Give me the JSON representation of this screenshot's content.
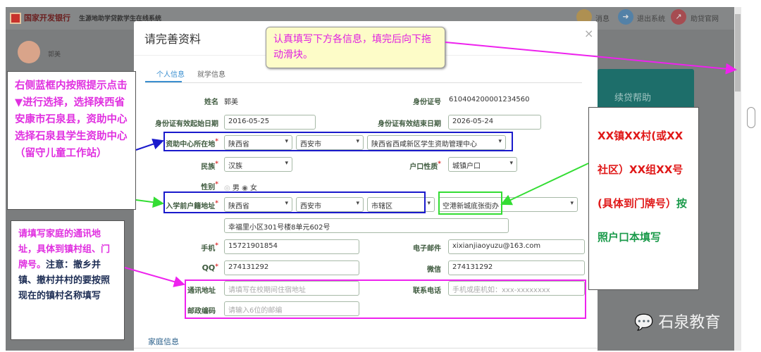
{
  "header": {
    "bank_name": "国家开发银行",
    "system_name": "生源地助学贷款学生在线系统",
    "actions": [
      {
        "label": "消息",
        "icon": "bell-icon",
        "color": "#c9962e"
      },
      {
        "label": "退出系统",
        "icon": "logout-icon",
        "color": "#3f7fb5"
      },
      {
        "label": "助贷官网",
        "icon": "external-link-icon",
        "color": "#b5343a"
      }
    ]
  },
  "sidebar": {
    "user_name": "郭美",
    "card_label": "续贷帮助"
  },
  "modal": {
    "title": "请完善资料",
    "close": "×",
    "tabs": [
      {
        "label": "个人信息",
        "active": true
      },
      {
        "label": "就学信息",
        "active": false
      }
    ],
    "fields": {
      "name": {
        "label": "姓名",
        "value": "郭美"
      },
      "id_number": {
        "label": "身份证号",
        "value": "610404200001234560"
      },
      "id_start": {
        "label": "身份证有效起始日期",
        "value": "2016-05-25"
      },
      "id_end": {
        "label": "身份证有效结束日期",
        "value": "2026-05-24"
      },
      "aid_center": {
        "label": "资助中心所在地",
        "province": "陕西省",
        "city": "西安市",
        "center": "陕西省西咸新区学生资助管理中心"
      },
      "ethnicity": {
        "label": "民族",
        "value": "汉族"
      },
      "hukou_type": {
        "label": "户口性质",
        "value": "城镇户口"
      },
      "gender": {
        "label": "性别",
        "options": [
          "男",
          "女"
        ],
        "selected": "女"
      },
      "hukou_addr": {
        "label": "入学前户籍地址",
        "province": "陕西省",
        "city": "西安市",
        "district": "市辖区",
        "street": "空港新城底张街办",
        "detail": "幸福里小区301号楼8单元602号"
      },
      "mobile": {
        "label": "手机",
        "value": "15721901854"
      },
      "email": {
        "label": "电子邮件",
        "value": "xixianjiaoyuzu@163.com"
      },
      "qq": {
        "label": "QQ",
        "value": "274131292"
      },
      "wechat": {
        "label": "微信",
        "value": "274131292"
      },
      "mail_addr": {
        "label": "通讯地址",
        "placeholder": "请填写在校期间住宿地址"
      },
      "phone": {
        "label": "联系电话",
        "placeholder": "手机或座机如：xxx-xxxxxxxx"
      },
      "postcode": {
        "label": "邮政编码",
        "placeholder": "请输入6位的邮编"
      }
    },
    "section_family": "家庭信息"
  },
  "annotations": {
    "top": "认真填写下方各信息，填完后向下拖动滑块。",
    "left1": "右侧蓝框内按照提示点击▼进行选择，选择陕西省安康市石泉县，资助中心选择石泉县学生资助中心（留守儿童工作站）",
    "left2_pink": "请填写家庭的通讯地址，具体到镇村组、门牌号。",
    "left2_dark": "注意：撤乡并镇、撤村并村的要按照现在的镇村名称填写",
    "right_red": "XX镇XX村(或XX 社区）XX组XX号(具体到门牌号）",
    "right_green": "按照户口本填写"
  },
  "watermark": "石泉教育",
  "colors": {
    "blue_box": "#1a1acc",
    "green_box": "#33dd33",
    "magenta": "#ee22ee",
    "teal": "#1d6e6a"
  }
}
